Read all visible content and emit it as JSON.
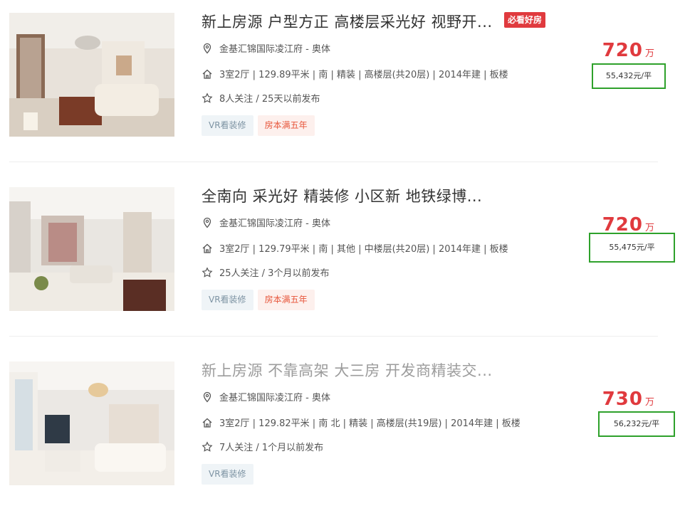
{
  "listings": [
    {
      "title": "新上房源 户型方正 高楼层采光好 视野开...",
      "badge": "必看好房",
      "community": "金基汇锦国际凌江府 - 奥体",
      "specs": "3室2厅 | 129.89平米 | 南 | 精装 | 高楼层(共20层) | 2014年建 | 板楼",
      "follow": "8人关注 / 25天以前发布",
      "tags": [
        "VR看装修",
        "房本满五年"
      ],
      "price": "720",
      "price_unit": "万",
      "unit_price": "55,432元/平",
      "visited": false
    },
    {
      "title": "全南向 采光好 精装修 小区新 地铁绿博...",
      "badge": "",
      "community": "金基汇锦国际凌江府 - 奥体",
      "specs": "3室2厅 | 129.79平米 | 南 | 其他 | 中楼层(共20层) | 2014年建 | 板楼",
      "follow": "25人关注 / 3个月以前发布",
      "tags": [
        "VR看装修",
        "房本满五年"
      ],
      "price": "720",
      "price_unit": "万",
      "unit_price": "55,475元/平",
      "visited": false
    },
    {
      "title": "新上房源 不靠高架 大三房 开发商精装交...",
      "badge": "",
      "community": "金基汇锦国际凌江府 - 奥体",
      "specs": "3室2厅 | 129.82平米 | 南 北 | 精装 | 高楼层(共19层) | 2014年建 | 板楼",
      "follow": "7人关注 / 1个月以前发布",
      "tags": [
        "VR看装修"
      ],
      "price": "730",
      "price_unit": "万",
      "unit_price": "56,232元/平",
      "visited": true
    }
  ],
  "icons": {
    "location": "location-pin-icon",
    "house": "house-icon",
    "follow": "star-icon"
  },
  "colors": {
    "price": "#e03a3e",
    "highlight_box": "#2ea12b",
    "badge": "#e03a3e"
  }
}
